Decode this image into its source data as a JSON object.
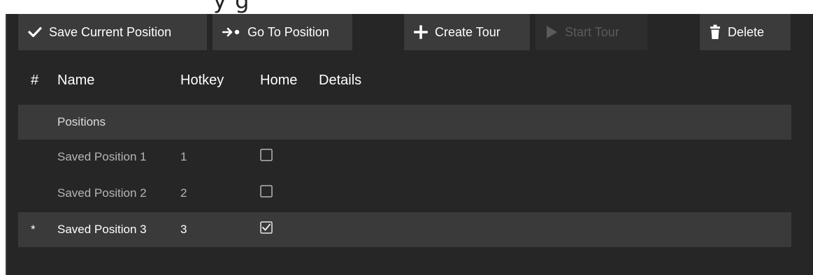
{
  "top_fragment": {
    "text": "y                        g"
  },
  "toolbar": {
    "save_label": "Save Current Position",
    "goto_label": "Go To Position",
    "create_label": "Create Tour",
    "start_label": "Start Tour",
    "delete_label": "Delete"
  },
  "table": {
    "columns": [
      "#",
      "Name",
      "Hotkey",
      "Home",
      "Details"
    ],
    "group_label": "Positions",
    "rows": [
      {
        "marker": "",
        "name": "Saved Position 1",
        "hotkey": "1",
        "home": false
      },
      {
        "marker": "",
        "name": "Saved Position 2",
        "hotkey": "2",
        "home": false
      },
      {
        "marker": "*",
        "name": "Saved Position 3",
        "hotkey": "3",
        "home": true
      }
    ]
  },
  "colors": {
    "background": "#262626",
    "button": "#3b3b3b",
    "row_highlight": "#3a3a3a",
    "text": "#ffffff",
    "muted_text": "#b5b5b5"
  },
  "icons": {
    "save": "checkmark-icon",
    "goto": "arrow-dot-icon",
    "create": "plus-icon",
    "start": "play-icon",
    "delete": "trash-icon"
  }
}
